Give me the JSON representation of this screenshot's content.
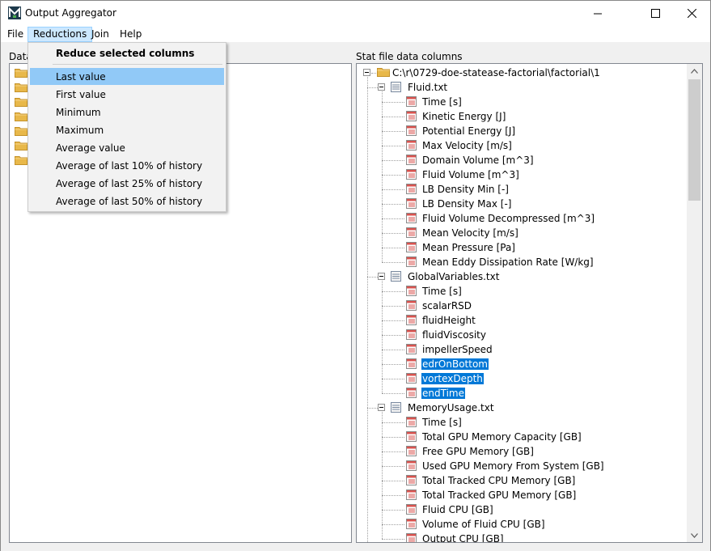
{
  "window": {
    "title": "Output Aggregator"
  },
  "menu": {
    "file": "File",
    "reductions": "Reductions",
    "join": "Join",
    "help": "Help"
  },
  "reductions_menu": {
    "header": "Reduce selected columns",
    "items": [
      "Last value",
      "First value",
      "Minimum",
      "Maximum",
      "Average value",
      "Average of last 10% of history",
      "Average of last 25% of history",
      "Average of last 50% of history"
    ],
    "highlighted_index": 0
  },
  "left_pane": {
    "label": "Data",
    "folder_count": 7
  },
  "right_pane": {
    "label": "Stat file data columns",
    "root": "C:\\r\\0729-doe-statease-factorial\\factorial\\1",
    "files": [
      {
        "name": "Fluid.txt",
        "columns": [
          "Time [s]",
          "Kinetic Energy [J]",
          "Potential Energy [J]",
          "Max Velocity [m/s]",
          "Domain Volume [m^3]",
          "Fluid Volume [m^3]",
          "LB Density Min [-]",
          "LB Density Max [-]",
          "Fluid Volume Decompressed [m^3]",
          "Mean Velocity [m/s]",
          "Mean Pressure [Pa]",
          "Mean Eddy Dissipation Rate [W/kg]"
        ]
      },
      {
        "name": "GlobalVariables.txt",
        "columns": [
          "Time [s]",
          "scalarRSD",
          "fluidHeight",
          "fluidViscosity",
          "impellerSpeed",
          "edrOnBottom",
          "vortexDepth",
          "endTime"
        ],
        "selected": [
          "edrOnBottom",
          "vortexDepth",
          "endTime"
        ]
      },
      {
        "name": "MemoryUsage.txt",
        "columns": [
          "Time [s]",
          "Total GPU Memory Capacity [GB]",
          "Free GPU Memory [GB]",
          "Used GPU Memory From System [GB]",
          "Total Tracked CPU Memory [GB]",
          "Total Tracked GPU Memory [GB]",
          "Fluid CPU [GB]",
          "Volume of Fluid CPU [GB]",
          "Output CPU [GB]"
        ]
      }
    ]
  },
  "colors": {
    "selection": "#0078d7",
    "menu_highlight": "#91c9f7",
    "folder": "#e8b84a"
  }
}
